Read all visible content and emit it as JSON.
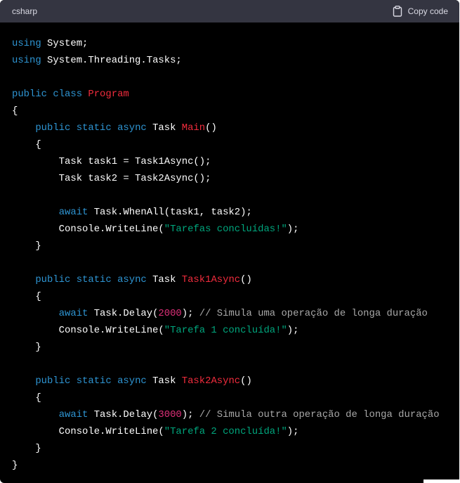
{
  "header": {
    "language": "csharp",
    "copy_label": "Copy code",
    "copy_icon": "clipboard-icon"
  },
  "colors": {
    "keyword": "#2e95d3",
    "class_or_function_name": "#f22c3d",
    "string": "#00a67d",
    "number": "#df3079",
    "comment": "#a8a8a8",
    "text": "#ffffff",
    "header_bg": "#343541",
    "code_bg": "#000000"
  },
  "code": {
    "lines": [
      [
        {
          "t": "kw",
          "v": "using"
        },
        {
          "t": "ty",
          "v": " System;"
        }
      ],
      [
        {
          "t": "kw",
          "v": "using"
        },
        {
          "t": "ty",
          "v": " System.Threading.Tasks;"
        }
      ],
      [],
      [
        {
          "t": "kw",
          "v": "public"
        },
        {
          "t": "ty",
          "v": " "
        },
        {
          "t": "kw",
          "v": "class"
        },
        {
          "t": "ty",
          "v": " "
        },
        {
          "t": "fn",
          "v": "Program"
        }
      ],
      [
        {
          "t": "ty",
          "v": "{"
        }
      ],
      [
        {
          "t": "ty",
          "v": "    "
        },
        {
          "t": "kw",
          "v": "public"
        },
        {
          "t": "ty",
          "v": " "
        },
        {
          "t": "kw",
          "v": "static"
        },
        {
          "t": "ty",
          "v": " "
        },
        {
          "t": "kw",
          "v": "async"
        },
        {
          "t": "ty",
          "v": " Task "
        },
        {
          "t": "fn",
          "v": "Main"
        },
        {
          "t": "ty",
          "v": "()"
        }
      ],
      [
        {
          "t": "ty",
          "v": "    {"
        }
      ],
      [
        {
          "t": "ty",
          "v": "        Task task1 = Task1Async();"
        }
      ],
      [
        {
          "t": "ty",
          "v": "        Task task2 = Task2Async();"
        }
      ],
      [],
      [
        {
          "t": "ty",
          "v": "        "
        },
        {
          "t": "kw",
          "v": "await"
        },
        {
          "t": "ty",
          "v": " Task.WhenAll(task1, task2);"
        }
      ],
      [
        {
          "t": "ty",
          "v": "        Console.WriteLine("
        },
        {
          "t": "str",
          "v": "\"Tarefas concluídas!\""
        },
        {
          "t": "ty",
          "v": ");"
        }
      ],
      [
        {
          "t": "ty",
          "v": "    }"
        }
      ],
      [],
      [
        {
          "t": "ty",
          "v": "    "
        },
        {
          "t": "kw",
          "v": "public"
        },
        {
          "t": "ty",
          "v": " "
        },
        {
          "t": "kw",
          "v": "static"
        },
        {
          "t": "ty",
          "v": " "
        },
        {
          "t": "kw",
          "v": "async"
        },
        {
          "t": "ty",
          "v": " Task "
        },
        {
          "t": "fn",
          "v": "Task1Async"
        },
        {
          "t": "ty",
          "v": "()"
        }
      ],
      [
        {
          "t": "ty",
          "v": "    {"
        }
      ],
      [
        {
          "t": "ty",
          "v": "        "
        },
        {
          "t": "kw",
          "v": "await"
        },
        {
          "t": "ty",
          "v": " Task.Delay("
        },
        {
          "t": "num",
          "v": "2000"
        },
        {
          "t": "ty",
          "v": "); "
        },
        {
          "t": "cm",
          "v": "// Simula uma operação de longa duração"
        }
      ],
      [
        {
          "t": "ty",
          "v": "        Console.WriteLine("
        },
        {
          "t": "str",
          "v": "\"Tarefa 1 concluída!\""
        },
        {
          "t": "ty",
          "v": ");"
        }
      ],
      [
        {
          "t": "ty",
          "v": "    }"
        }
      ],
      [],
      [
        {
          "t": "ty",
          "v": "    "
        },
        {
          "t": "kw",
          "v": "public"
        },
        {
          "t": "ty",
          "v": " "
        },
        {
          "t": "kw",
          "v": "static"
        },
        {
          "t": "ty",
          "v": " "
        },
        {
          "t": "kw",
          "v": "async"
        },
        {
          "t": "ty",
          "v": " Task "
        },
        {
          "t": "fn",
          "v": "Task2Async"
        },
        {
          "t": "ty",
          "v": "()"
        }
      ],
      [
        {
          "t": "ty",
          "v": "    {"
        }
      ],
      [
        {
          "t": "ty",
          "v": "        "
        },
        {
          "t": "kw",
          "v": "await"
        },
        {
          "t": "ty",
          "v": " Task.Delay("
        },
        {
          "t": "num",
          "v": "3000"
        },
        {
          "t": "ty",
          "v": "); "
        },
        {
          "t": "cm",
          "v": "// Simula outra operação de longa duração"
        }
      ],
      [
        {
          "t": "ty",
          "v": "        Console.WriteLine("
        },
        {
          "t": "str",
          "v": "\"Tarefa 2 concluída!\""
        },
        {
          "t": "ty",
          "v": ");"
        }
      ],
      [
        {
          "t": "ty",
          "v": "    }"
        }
      ],
      [
        {
          "t": "ty",
          "v": "}"
        }
      ]
    ]
  }
}
